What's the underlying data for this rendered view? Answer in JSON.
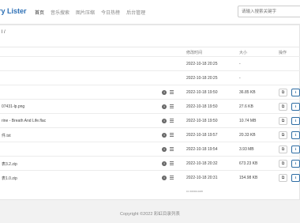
{
  "header": {
    "brand": "ry Lister",
    "nav": [
      "首页",
      "音乐搜索",
      "图片压缩",
      "今日热榜",
      "后台管理"
    ],
    "search_placeholder": "请输入搜索关键字"
  },
  "breadcrumb": "l /",
  "table": {
    "columns": {
      "time": "修改时间",
      "size": "大小",
      "actions": "操作"
    },
    "rows": [
      {
        "name": "",
        "time": "2022-10-18 20:25",
        "size": "-",
        "has_actions": false
      },
      {
        "name": "",
        "time": "2022-10-18 20:25",
        "size": "-",
        "has_actions": false
      },
      {
        "name": "",
        "time": "2022-10-18 19:50",
        "size": "36.85 KB",
        "has_actions": true
      },
      {
        "name": "07431-lp.png",
        "time": "2022-10-18 19:50",
        "size": "27.6 KB",
        "has_actions": true
      },
      {
        "name": "rine - Breath And Life.flac",
        "time": "2022-10-18 19:50",
        "size": "10.74 MB",
        "has_actions": true
      },
      {
        "name": "件.txt",
        "time": "2022-10-18 19:57",
        "size": "20.33 KB",
        "has_actions": true
      },
      {
        "name": "",
        "time": "2022-10-18 19:54",
        "size": "3.93 MB",
        "has_actions": true
      },
      {
        "name": "表3.2.zip",
        "time": "2022-10-18 20:32",
        "size": "673.23 KB",
        "has_actions": true
      },
      {
        "name": "表1.0.zip",
        "time": "2022-10-18 20:31",
        "size": "154.98 KB",
        "has_actions": true
      }
    ]
  },
  "tail_text": "••• xxxxx.com",
  "footer": "Copyright ©2022 彩虹目录列表"
}
